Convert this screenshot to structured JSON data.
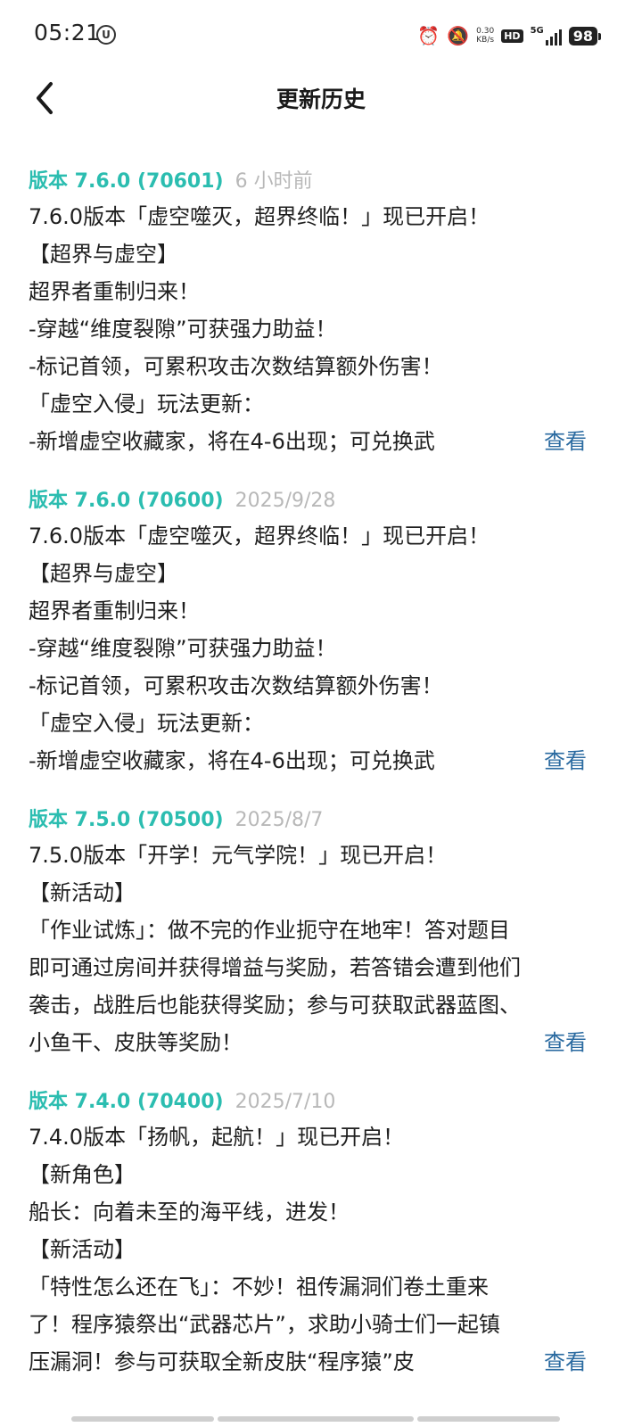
{
  "status": {
    "time": "05:21",
    "speed_value": "0.30",
    "speed_unit": "KB/s",
    "hd": "HD",
    "network": "5G",
    "battery": "98"
  },
  "header": {
    "title": "更新历史"
  },
  "entries": [
    {
      "version": "版本 7.6.0 (70601)",
      "date": "6 小时前",
      "lines": [
        "7.6.0版本「虚空噬灭，超界终临！」现已开启！",
        "【超界与虚空】",
        "超界者重制归来！",
        "-穿越“维度裂隙”可获强力助益！",
        "-标记首领，可累积攻击次数结算额外伤害！",
        "「虚空入侵」玩法更新：",
        "-新增虚空收藏家，将在4-6出现；可兑换武"
      ],
      "view_label": "查看"
    },
    {
      "version": "版本 7.6.0 (70600)",
      "date": "2025/9/28",
      "lines": [
        "7.6.0版本「虚空噬灭，超界终临！」现已开启！",
        "【超界与虚空】",
        "超界者重制归来！",
        "-穿越“维度裂隙”可获强力助益！",
        "-标记首领，可累积攻击次数结算额外伤害！",
        "「虚空入侵」玩法更新：",
        "-新增虚空收藏家，将在4-6出现；可兑换武"
      ],
      "view_label": "查看"
    },
    {
      "version": "版本 7.5.0 (70500)",
      "date": "2025/8/7",
      "lines": [
        "7.5.0版本「开学！元气学院！」现已开启！",
        "【新活动】",
        "「作业试炼」：做不完的作业扼守在地牢！答对题目",
        "即可通过房间并获得增益与奖励，若答错会遭到他们",
        "袭击，战胜后也能获得奖励；参与可获取武器蓝图、",
        "小鱼干、皮肤等奖励！"
      ],
      "view_label": "查看"
    },
    {
      "version": "版本 7.4.0 (70400)",
      "date": "2025/7/10",
      "lines": [
        "7.4.0版本「扬帆，起航！」现已开启！",
        "【新角色】",
        "船长：向着未至的海平线，进发！",
        "【新活动】",
        "「特性怎么还在飞」：不妙！祖传漏洞们卷土重来",
        "了！程序猿祭出“武器芯片”，求助小骑士们一起镇",
        "压漏洞！参与可获取全新皮肤“程序猿”皮"
      ],
      "view_label": "查看"
    }
  ]
}
